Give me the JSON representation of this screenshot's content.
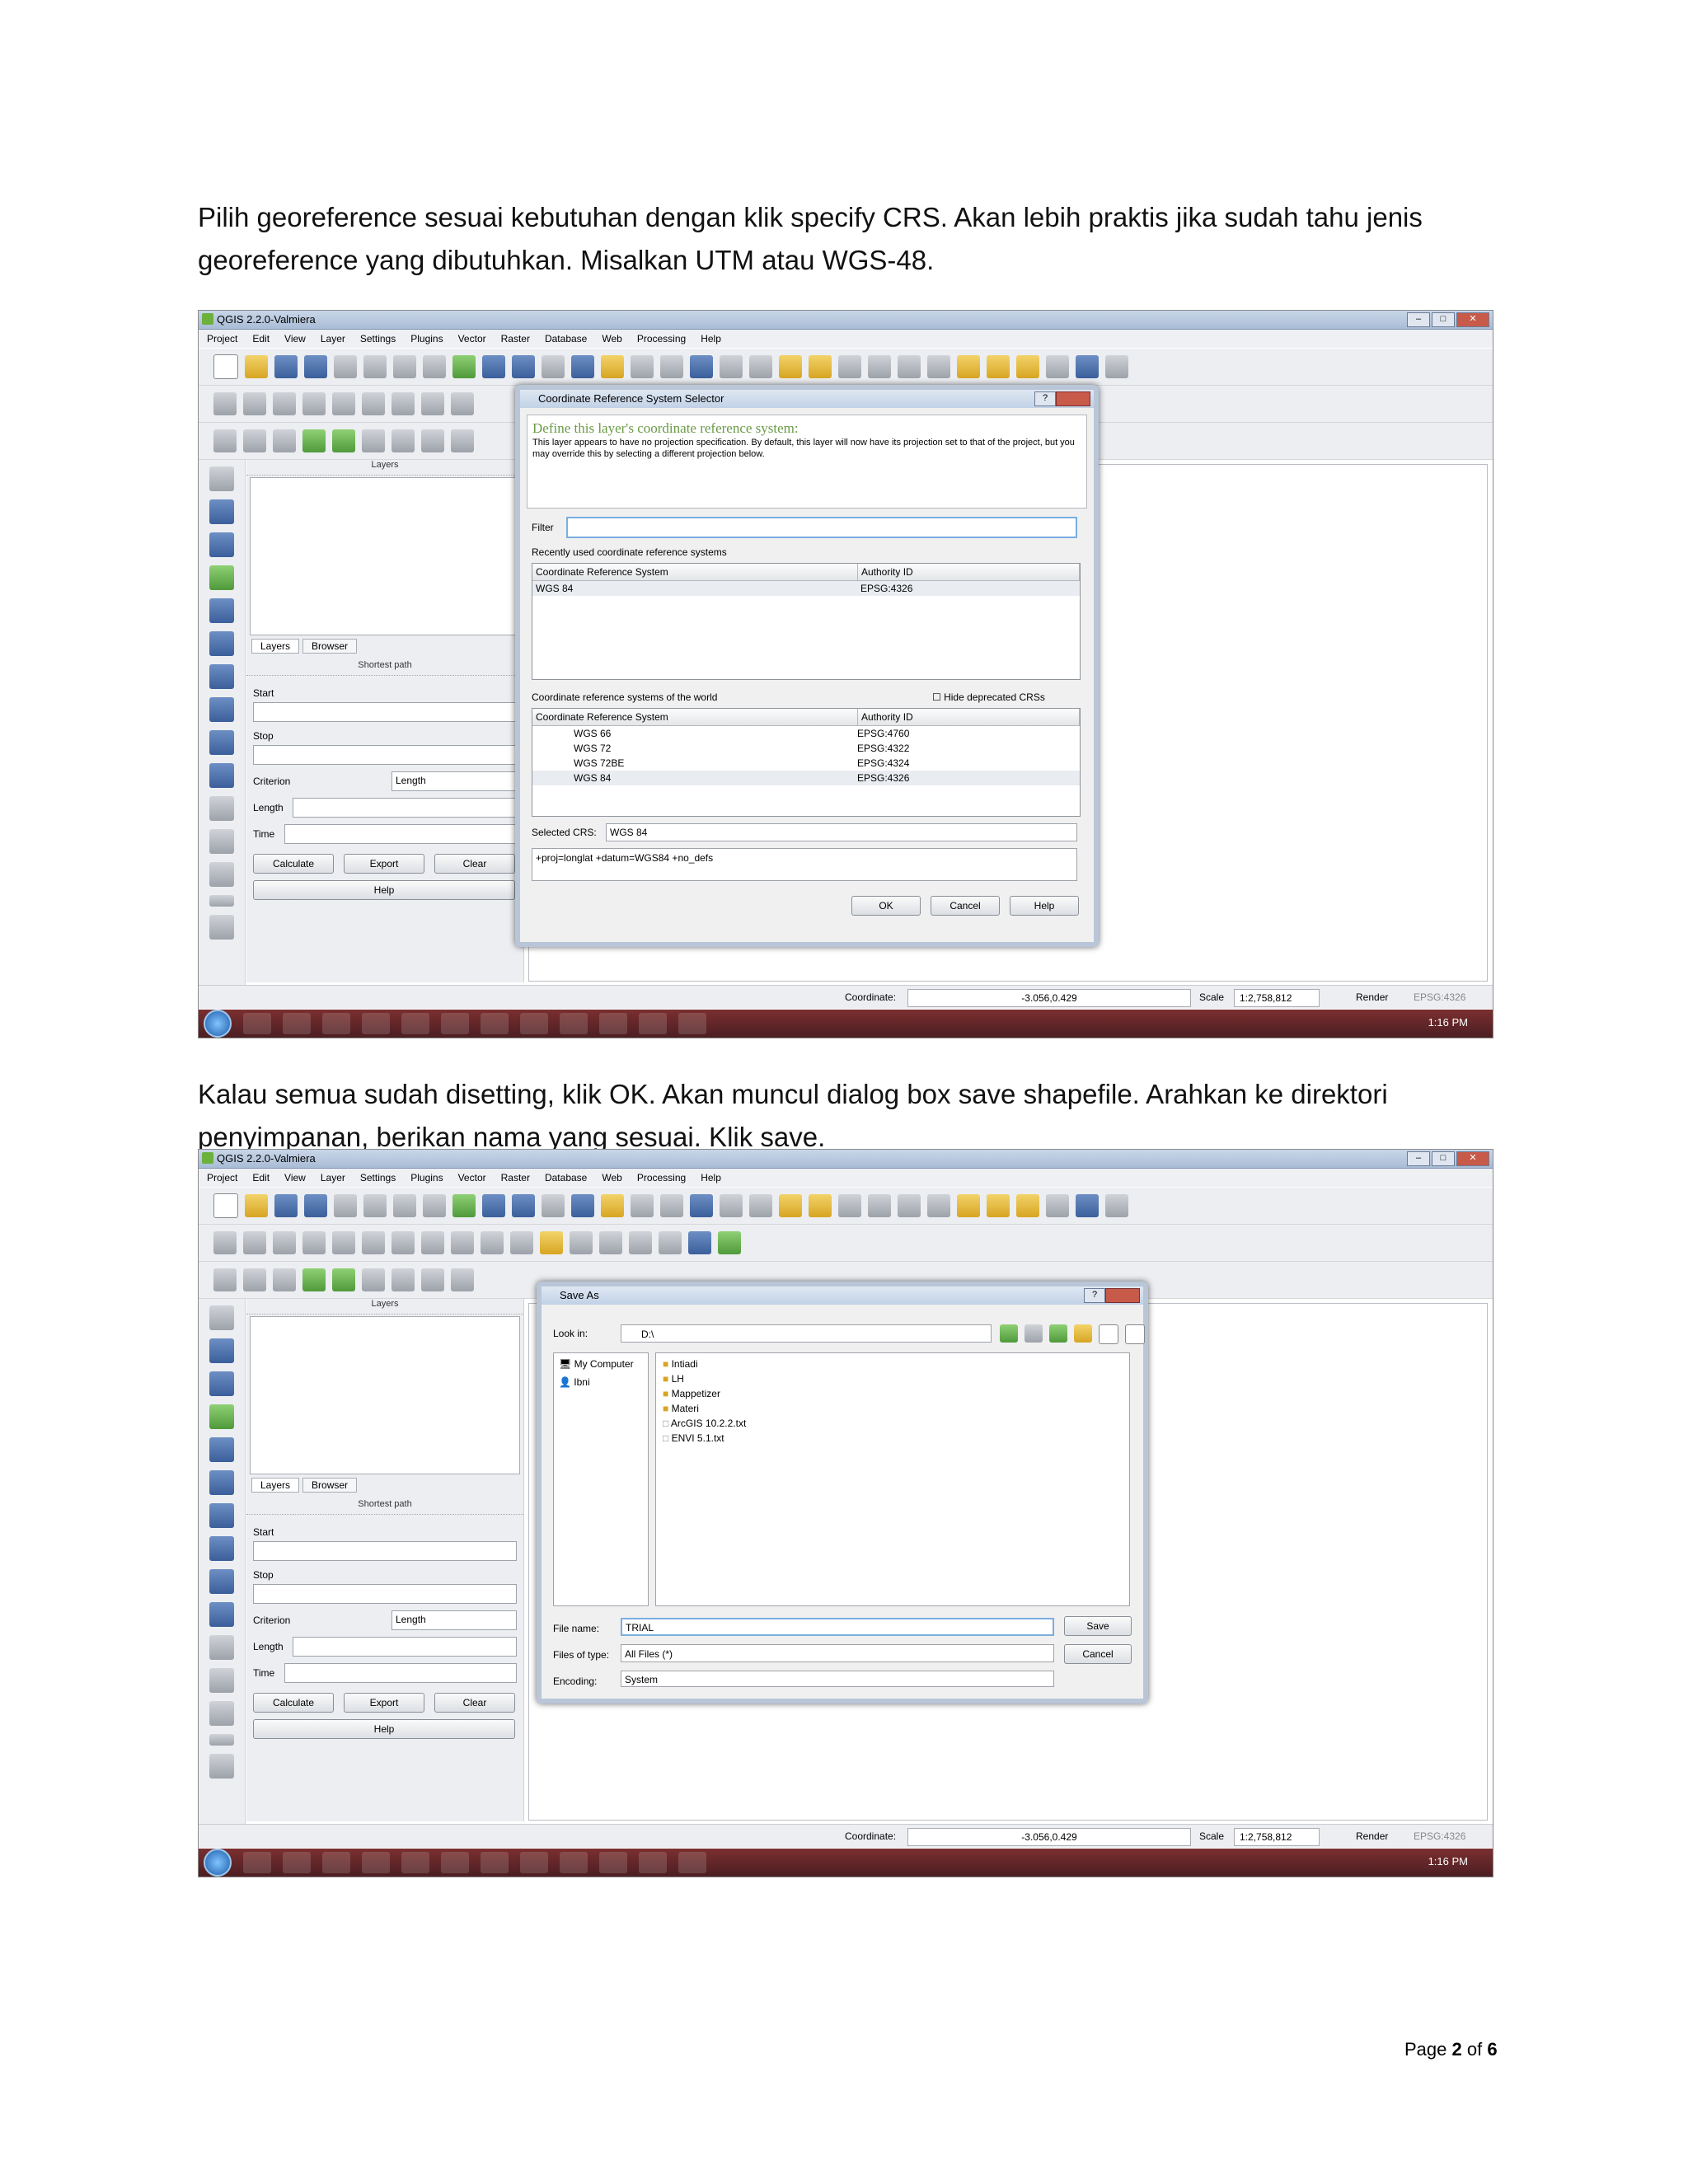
{
  "paragraph1": {
    "line1": "Pilih georeference sesuai kebutuhan dengan klik specify CRS. Akan lebih praktis jika sudah tahu jenis",
    "line2": "georeference yang dibutuhkan. Misalkan UTM atau WGS-48."
  },
  "paragraph2": {
    "line1": "Kalau semua sudah disetting, klik OK. Akan muncul dialog box save shapefile. Arahkan ke direktori",
    "line2": "penyimpanan, berikan nama yang sesuai. Klik save."
  },
  "qgis": {
    "window_title": "QGIS 2.2.0-Valmiera",
    "menu": [
      "Project",
      "Edit",
      "View",
      "Layer",
      "Settings",
      "Plugins",
      "Vector",
      "Raster",
      "Database",
      "Web",
      "Processing",
      "Help"
    ],
    "layers_panel_title": "Layers",
    "tabs": [
      "Layers",
      "Browser"
    ],
    "shortest_path_title": "Shortest path",
    "start_label": "Start",
    "stop_label": "Stop",
    "criterion_label": "Criterion",
    "criterion_value": "Length",
    "length_label": "Length",
    "time_label": "Time",
    "calculate_button": "Calculate",
    "export_button": "Export",
    "clear_button": "Clear",
    "help_button": "Help",
    "status": {
      "coordinate_label": "Coordinate:",
      "coordinate_value": "-3.056,0.429",
      "scale_label": "Scale",
      "scale_value": "1:2,758,812",
      "render_label": "Render",
      "epsg": "EPSG:4326"
    },
    "clock": "1:16 PM"
  },
  "crs_dialog": {
    "title": "Coordinate Reference System Selector",
    "heading": "Define this layer's coordinate reference system:",
    "description": "This layer appears to have no projection specification. By default, this layer will now have its projection set to that of the project, but you may override this by selecting a different projection below.",
    "filter_label": "Filter",
    "recent_label": "Recently used coordinate reference systems",
    "col_crs": "Coordinate Reference System",
    "col_authority": "Authority ID",
    "recent_rows": [
      {
        "name": "WGS 84",
        "id": "EPSG:4326"
      }
    ],
    "world_label": "Coordinate reference systems of the world",
    "hide_deprecated": "Hide deprecated CRSs",
    "world_rows": [
      {
        "name": "WGS 66",
        "id": "EPSG:4760"
      },
      {
        "name": "WGS 72",
        "id": "EPSG:4322"
      },
      {
        "name": "WGS 72BE",
        "id": "EPSG:4324"
      },
      {
        "name": "WGS 84",
        "id": "EPSG:4326"
      }
    ],
    "selected_label": "Selected CRS:",
    "selected_value": "WGS 84",
    "proj_string": "+proj=longlat +datum=WGS84 +no_defs",
    "ok": "OK",
    "cancel": "Cancel",
    "help": "Help"
  },
  "save_dialog": {
    "title": "Save As",
    "look_in_label": "Look in:",
    "look_in_value": "D:\\",
    "places": [
      "My Computer",
      "Ibni"
    ],
    "files": [
      "Intiadi",
      "LH",
      "Mappetizer",
      "Materi",
      "ArcGIS 10.2.2.txt",
      "ENVI 5.1.txt"
    ],
    "file_name_label": "File name:",
    "file_name_value": "TRIAL",
    "files_of_type_label": "Files of type:",
    "files_of_type_value": "All Files (*)",
    "encoding_label": "Encoding:",
    "encoding_value": "System",
    "save": "Save",
    "cancel": "Cancel"
  },
  "footer": {
    "page_prefix": "Page",
    "page_current": "2",
    "page_of": "of",
    "page_total": "6"
  }
}
